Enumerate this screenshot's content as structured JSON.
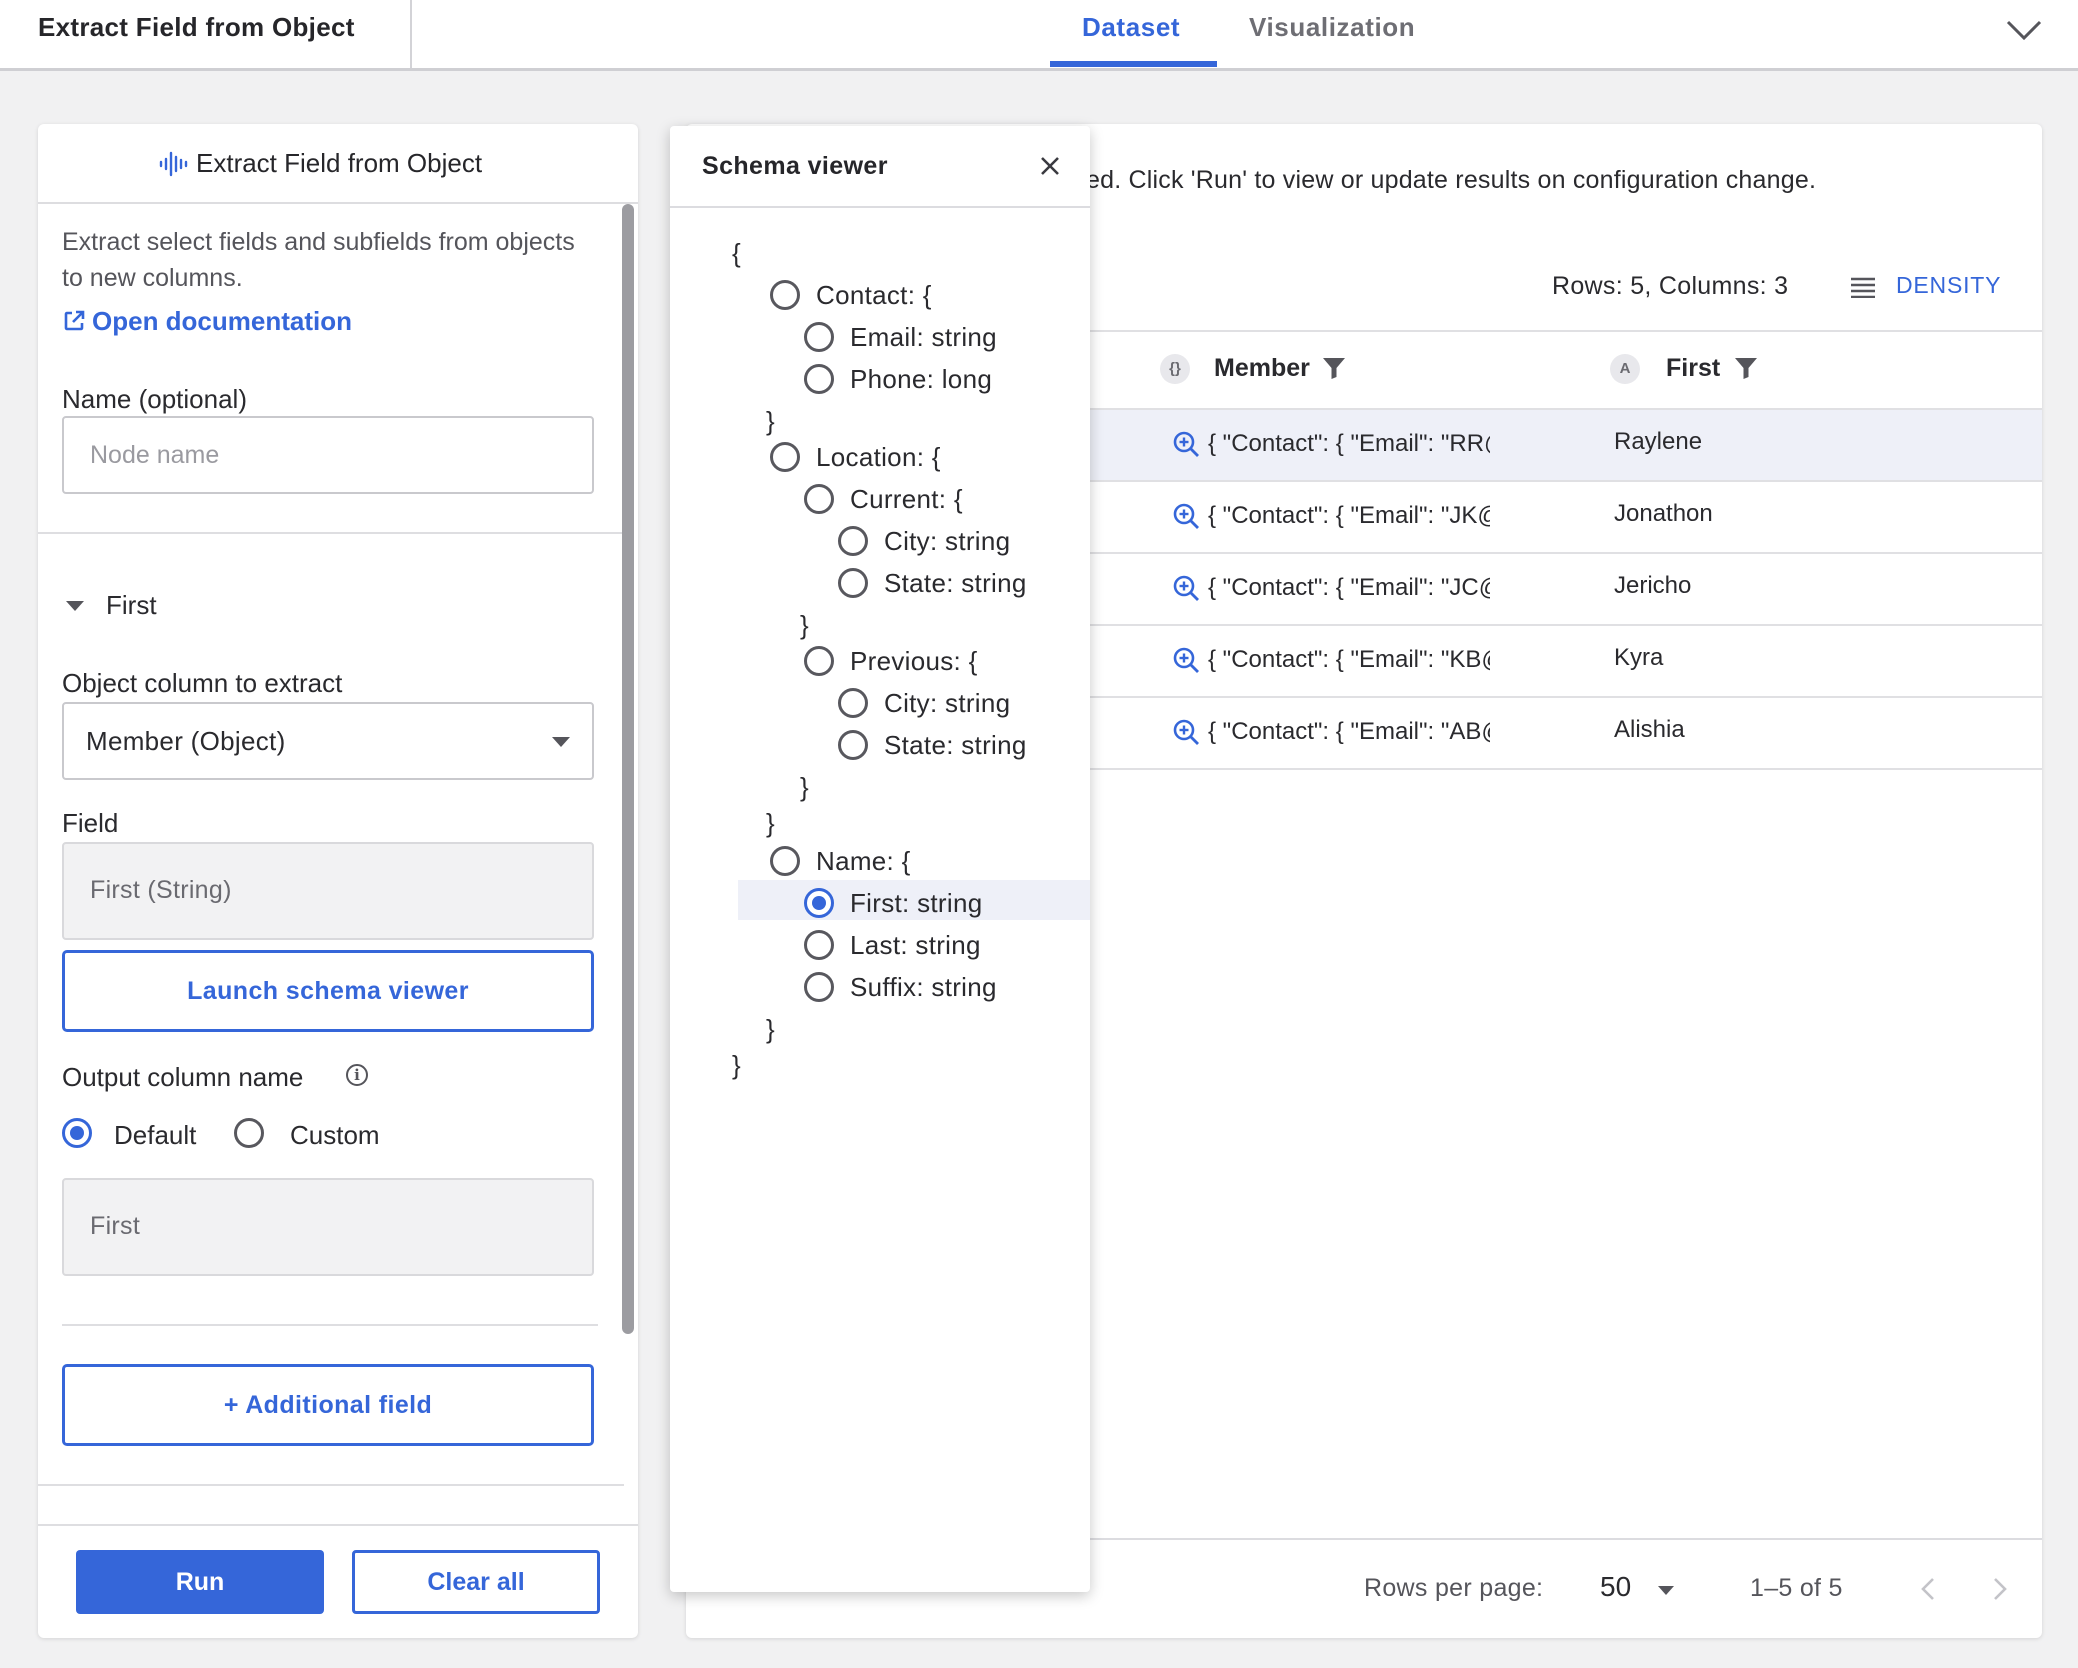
{
  "header": {
    "title": "Extract Field from Object",
    "tabs": [
      {
        "label": "Dataset",
        "active": true
      },
      {
        "label": "Visualization",
        "active": false
      }
    ],
    "accent_color": "#3566d9"
  },
  "left_panel": {
    "title": "Extract Field from Object",
    "description": "Extract select fields and subfields from objects to new columns.",
    "doc_link": "Open documentation",
    "name_label": "Name (optional)",
    "name_placeholder": "Node name",
    "section_title": "First",
    "object_column_label": "Object column to extract",
    "object_column_value": "Member (Object)",
    "field_label": "Field",
    "field_value": "First (String)",
    "launch_button": "Launch schema viewer",
    "output_label": "Output column name",
    "output_options": [
      {
        "label": "Default",
        "selected": true
      },
      {
        "label": "Custom",
        "selected": false
      }
    ],
    "output_value": "First",
    "additional_field_button": "+ Additional field",
    "run_button": "Run",
    "clear_button": "Clear all"
  },
  "schema_viewer": {
    "title": "Schema viewer",
    "lines": [
      {
        "text": "{",
        "radio": false
      },
      {
        "text": "Contact: {",
        "radio": true,
        "selected": false
      },
      {
        "text": "Email: string",
        "radio": true,
        "selected": false
      },
      {
        "text": "Phone: long",
        "radio": true,
        "selected": false
      },
      {
        "text": "}",
        "radio": false
      },
      {
        "text": "Location: {",
        "radio": true,
        "selected": false
      },
      {
        "text": "Current: {",
        "radio": true,
        "selected": false
      },
      {
        "text": "City: string",
        "radio": true,
        "selected": false
      },
      {
        "text": "State: string",
        "radio": true,
        "selected": false
      },
      {
        "text": "}",
        "radio": false
      },
      {
        "text": "Previous: {",
        "radio": true,
        "selected": false
      },
      {
        "text": "City: string",
        "radio": true,
        "selected": false
      },
      {
        "text": "State: string",
        "radio": true,
        "selected": false
      },
      {
        "text": "}",
        "radio": false
      },
      {
        "text": "}",
        "radio": false
      },
      {
        "text": "Name: {",
        "radio": true,
        "selected": false
      },
      {
        "text": "First: string",
        "radio": true,
        "selected": true
      },
      {
        "text": "Last: string",
        "radio": true,
        "selected": false
      },
      {
        "text": "Suffix: string",
        "radio": true,
        "selected": false
      },
      {
        "text": "}",
        "radio": false
      },
      {
        "text": "}",
        "radio": false
      }
    ]
  },
  "results": {
    "notice": "ed. Click 'Run' to view or update results on configuration change.",
    "row_count": "Rows: 5, Columns: 3",
    "density_label": "DENSITY",
    "columns": [
      {
        "icon": "{}",
        "name": "Member"
      },
      {
        "icon": "A",
        "name": "First"
      }
    ],
    "rows": [
      {
        "member": "{ \"Contact\": { \"Email\": \"RR@notarealemail.com\" } }",
        "first": "Raylene",
        "selected": true
      },
      {
        "member": "{ \"Contact\": { \"Email\": \"JK@notarealemail.com\" } }",
        "first": "Jonathon",
        "selected": false
      },
      {
        "member": "{ \"Contact\": { \"Email\": \"JC@notarealemail.com\" } }",
        "first": "Jericho",
        "selected": false
      },
      {
        "member": "{ \"Contact\": { \"Email\": \"KB@notarealemail.com\" } }",
        "first": "Kyra",
        "selected": false
      },
      {
        "member": "{ \"Contact\": { \"Email\": \"AB@notarealemail.com\" } }",
        "first": "Alishia",
        "selected": false
      }
    ],
    "rows_per_page_label": "Rows per page:",
    "rows_per_page_value": "50",
    "range": "1–5 of 5"
  }
}
